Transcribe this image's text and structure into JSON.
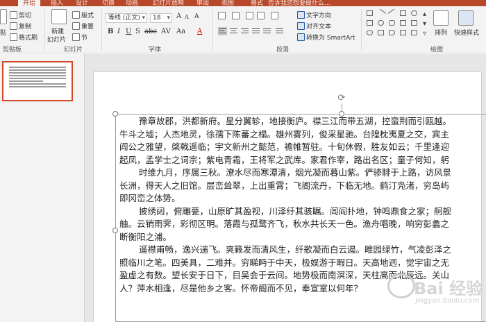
{
  "tabs": [
    {
      "label": "开始",
      "active": true
    },
    {
      "label": "插入"
    },
    {
      "label": "设计"
    },
    {
      "label": "切换"
    },
    {
      "label": "动画"
    },
    {
      "label": "幻灯片放映"
    },
    {
      "label": "审阅"
    },
    {
      "label": "视图"
    },
    {
      "label": "格式"
    }
  ],
  "tell_me": "告诉我您想要做什么...",
  "ribbon": {
    "clipboard": {
      "paste": "贴",
      "cut": "剪切",
      "copy": "复制",
      "format_painter": "格式刷",
      "label": "剪贴板"
    },
    "slides": {
      "new_slide_1": "新建",
      "new_slide_2": "幻灯片",
      "layout": "版式",
      "reset": "重置",
      "section": "节",
      "label": "幻灯片"
    },
    "font": {
      "name": "等线 (正文)",
      "size": "18",
      "label": "字体"
    },
    "paragraph": {
      "text_direction": "文字方向",
      "align_text": "对齐文本",
      "smartart": "转换为 SmartArt",
      "label": "段落"
    },
    "drawing": {
      "arrange": "排列",
      "quick_styles": "快速样式",
      "label": "绘图"
    }
  },
  "pane": {
    "slide_number": "1"
  },
  "slide_text": [
    "豫章故郡，洪都新府。星分翼轸，地接衡庐。襟三江而带五湖，控蛮荆而引瓯越。",
    "牛斗之墟；人杰地灵，徐孺下陈蕃之榻。雄州雾列，俊采星驰。台隍枕夷夏之交，宾主",
    "阎公之雅望，棨戟遥临；宇文新州之懿范，襜帷暂驻。十旬休假，胜友如云；千里逢迎",
    "起凤，孟学士之词宗；紫电青霜，王将军之武库。家君作宰，路出名区；童子何知，躬",
    "时维九月，序属三秋。潦水尽而寒潭清，烟光凝而暮山紫。俨骖騑于上路，访风景",
    "长洲，得天人之旧馆。层峦耸翠，上出重霄；飞阁流丹，下临无地。鹤汀凫渚，穷岛屿",
    "即冈峦之体势。",
    "披绣闼，俯雕甍，山原旷其盈视，川泽纡其骇瞩。闾阎扑地，钟鸣鼎食之家；舸舰",
    "舳。云销雨霁，彩彻区明。落霞与孤鹜齐飞，秋水共长天一色。渔舟唱晚，响穷彭蠡之",
    "断衡阳之浦。",
    "遥襟甫畅，逸兴遄飞。爽籁发而清风生，纤歌凝而白云遏。睢园绿竹，气凌彭泽之",
    "照临川之笔。四美具，二难并。穷睇眄于中天，极娱游于暇日。天高地迥，觉宇宙之无",
    "盈虚之有数。望长安于日下，目吴会于云间。地势极而南溟深，天柱高而北辰远。关山",
    "人？萍水相逢，尽是他乡之客。怀帝阍而不见，奉宣室以何年？"
  ],
  "watermark": {
    "text": "Bai 经验",
    "url": "jingyan.baidu.com"
  }
}
